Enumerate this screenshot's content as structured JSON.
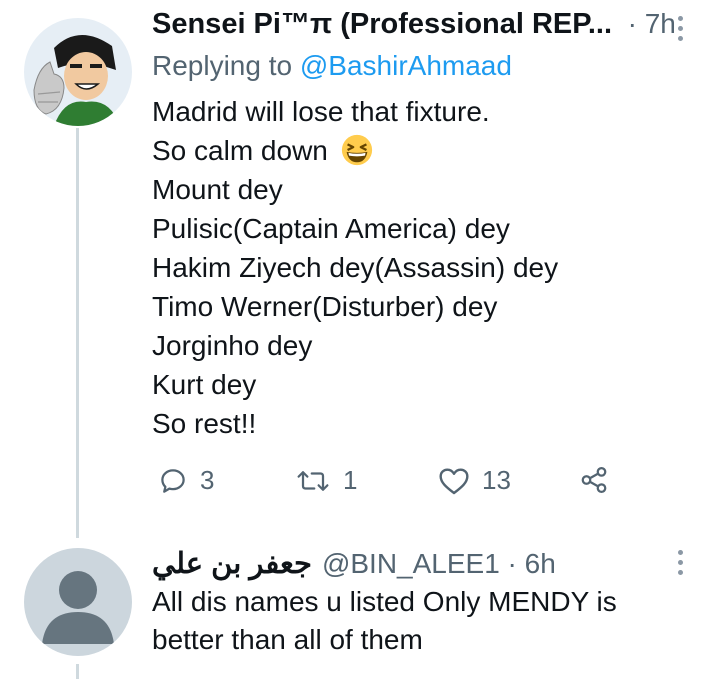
{
  "tweet1": {
    "display_name": "Sensei Pi™π (Professional REP...",
    "time": "7h",
    "replying_prefix": "Replying to ",
    "replying_to": "@BashirAhmaad",
    "lines": [
      "Madrid will lose that fixture.",
      "So calm down",
      "Mount dey",
      "Pulisic(Captain America) dey",
      "Hakim Ziyech dey(Assassin) dey",
      "Timo Werner(Disturber) dey",
      "Jorginho dey",
      "Kurt dey",
      "So rest!!"
    ],
    "emoji": "grinning-squinting-face",
    "reply_count": "3",
    "retweet_count": "1",
    "like_count": "13"
  },
  "tweet2": {
    "display_name": "جعفر بن علي",
    "handle": "@BIN_ALEE1",
    "time": "6h",
    "lines": [
      "All dis names u listed Only MENDY is",
      "better than all of them"
    ]
  },
  "colors": {
    "text": "#0f1419",
    "muted": "#536471",
    "link": "#1d9bf0",
    "thread_line": "#cfd9de",
    "default_avatar_bg": "#ccd6dd",
    "default_avatar_fg": "#66757f"
  },
  "icons": {
    "reply": "reply-icon",
    "retweet": "retweet-icon",
    "like": "heart-icon",
    "share": "share-icon",
    "more": "more-vertical-icon"
  }
}
